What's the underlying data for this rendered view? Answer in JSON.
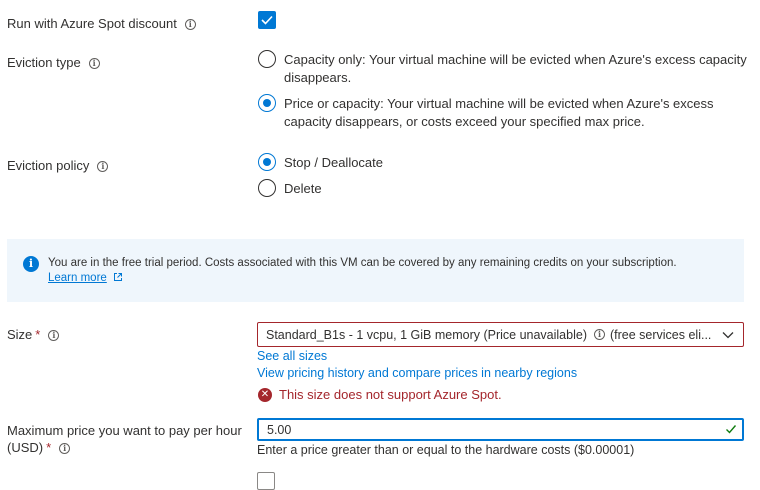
{
  "spot": {
    "label": "Run with Azure Spot discount",
    "checked": true
  },
  "eviction_type": {
    "label": "Eviction type",
    "options": [
      {
        "line1": "Capacity only: Your virtual machine will be evicted when Azure's excess capacity",
        "line2": "disappears.",
        "selected": false
      },
      {
        "line1": "Price or capacity: Your virtual machine will be evicted when Azure's excess",
        "line2": "capacity disappears, or costs exceed your specified max price.",
        "selected": true
      }
    ]
  },
  "eviction_policy": {
    "label": "Eviction policy",
    "options": [
      {
        "text": "Stop / Deallocate",
        "selected": true
      },
      {
        "text": "Delete",
        "selected": false
      }
    ]
  },
  "info_banner": {
    "text": "You are in the free trial period. Costs associated with this VM can be covered by any remaining credits on your subscription.",
    "link": "Learn more"
  },
  "size": {
    "label": "Size",
    "required_mark": "*",
    "selected_value": "Standard_B1s - 1 vcpu, 1 GiB memory (Price unavailable)",
    "selected_suffix": "(free services eli...",
    "see_all": "See all sizes",
    "pricing_link": "View pricing history and compare prices in nearby regions",
    "error": "This size does not support Azure Spot."
  },
  "max_price": {
    "label_line1": "Maximum price you want to pay per hour",
    "label_line2": "(USD)",
    "required_mark": "*",
    "value": "5.00",
    "hint": "Enter a price greater than or equal to the hardware costs ($0.00001)"
  },
  "colors": {
    "accent": "#0078d4",
    "error": "#a4262c",
    "valid": "#107c10",
    "info_bg": "#eff6fc"
  }
}
